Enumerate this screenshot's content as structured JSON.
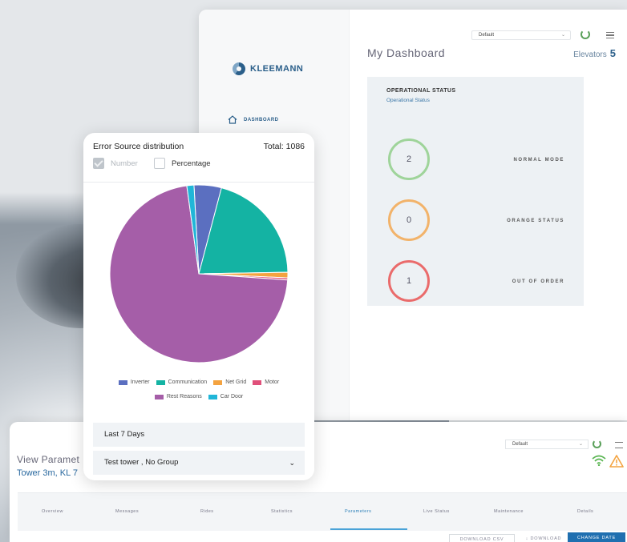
{
  "dashboard": {
    "brand": "KLEEMANN",
    "nav_dashboard": "DASHBOARD",
    "profile_select": "Default",
    "title": "My Dashboard",
    "elevators_label": "Elevators",
    "elevators_count": "5",
    "ops_title": "OPERATIONAL STATUS",
    "ops_subtitle": "Operational Status",
    "statuses": [
      {
        "label": "NORMAL MODE",
        "count": "2",
        "color": "#9fd49a"
      },
      {
        "label": "ORANGE STATUS",
        "count": "0",
        "color": "#f2b36a"
      },
      {
        "label": "OUT OF ORDER",
        "count": "1",
        "color": "#ea6b6b"
      }
    ]
  },
  "view_params": {
    "title": "View Paramet",
    "subtitle": "Tower 3m, KL 7",
    "profile_select": "Default",
    "tabs": [
      "Overview",
      "Messages",
      "Rides",
      "Statistics",
      "Parameters",
      "Live Status",
      "Maintenance",
      "Details"
    ],
    "active_tab": "Parameters",
    "download_csv": "DOWNLOAD CSV",
    "download": "↓ DOWNLOAD",
    "change_date": "CHANGE DATE"
  },
  "error_card": {
    "title": "Error Source distribution",
    "total": "Total: 1086",
    "opt_number": "Number",
    "opt_percentage": "Percentage",
    "period": "Last 7 Days",
    "group_select": "Test tower , No Group"
  },
  "chart_data": {
    "type": "pie",
    "title": "Error Source distribution",
    "total": 1086,
    "series": [
      {
        "name": "Inverter",
        "value": 54,
        "color": "#5b6fc0"
      },
      {
        "name": "Communication",
        "value": 224,
        "color": "#14b3a3"
      },
      {
        "name": "Net Grid",
        "value": 11,
        "color": "#f4a340"
      },
      {
        "name": "Motor",
        "value": 4,
        "color": "#e0507a"
      },
      {
        "name": "Rest Reasons",
        "value": 779,
        "color": "#a55ea8"
      },
      {
        "name": "Car Door",
        "value": 14,
        "color": "#20b6d8"
      }
    ],
    "legend_placement": "bottom"
  }
}
